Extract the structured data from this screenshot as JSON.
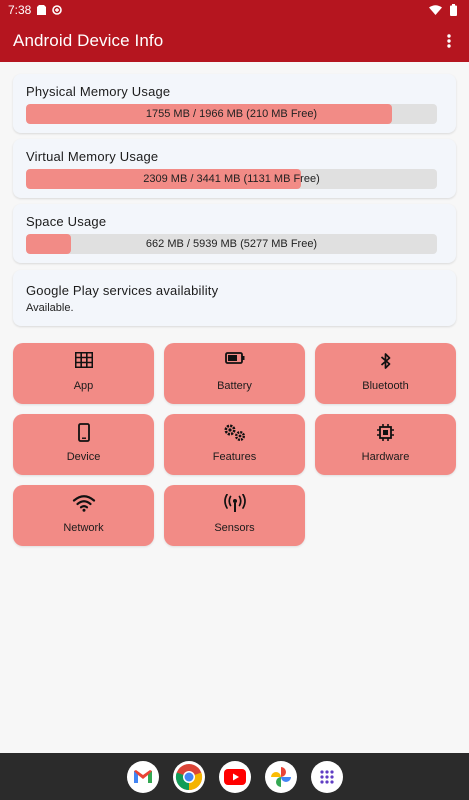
{
  "status": {
    "time": "7:38"
  },
  "appbar": {
    "title": "Android Device Info"
  },
  "colors": {
    "primary": "#b5151f",
    "bar_fill": "#f28b86",
    "tile": "#f28b86",
    "card": "#f3f6fb"
  },
  "memory_cards": [
    {
      "title": "Physical Memory Usage",
      "used_mb": 1755,
      "total_mb": 1966,
      "fraction_used": 0.89,
      "text": "1755 MB / 1966 MB (210 MB Free)"
    },
    {
      "title": "Virtual Memory Usage",
      "used_mb": 2309,
      "total_mb": 3441,
      "fraction_used": 0.67,
      "text": "2309 MB / 3441 MB (1131 MB Free)"
    },
    {
      "title": "Space Usage",
      "used_mb": 662,
      "total_mb": 5939,
      "fraction_used": 0.11,
      "text": "662 MB / 5939 MB (5277 MB Free)"
    }
  ],
  "gps_card": {
    "title": "Google Play services availability",
    "status": "Available."
  },
  "tiles": [
    {
      "label": "App",
      "icon": "grid-icon"
    },
    {
      "label": "Battery",
      "icon": "battery-icon"
    },
    {
      "label": "Bluetooth",
      "icon": "bluetooth-icon"
    },
    {
      "label": "Device",
      "icon": "phone-icon"
    },
    {
      "label": "Features",
      "icon": "gears-icon"
    },
    {
      "label": "Hardware",
      "icon": "chip-icon"
    },
    {
      "label": "Network",
      "icon": "wifi-icon"
    },
    {
      "label": "Sensors",
      "icon": "antenna-icon"
    }
  ],
  "dock": [
    "gmail-icon",
    "chrome-icon",
    "youtube-icon",
    "photos-icon",
    "app-drawer-icon"
  ]
}
